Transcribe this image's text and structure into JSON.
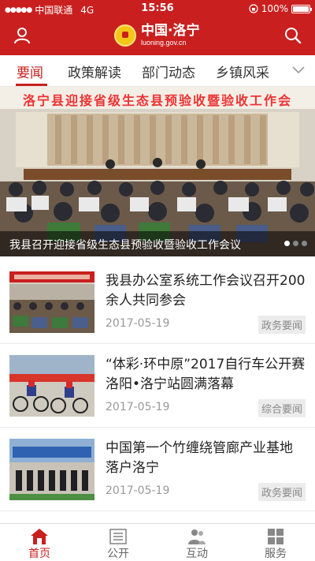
{
  "status_bar": {
    "carrier": "中国联通",
    "network": "4G",
    "time": "15:56",
    "battery": "100%"
  },
  "header": {
    "logo_title": "中国·洛宁",
    "logo_domain": "luoning.gov.cn",
    "user_icon": "user-icon",
    "search_icon": "search-icon"
  },
  "tabs": [
    {
      "label": "要闻",
      "active": true
    },
    {
      "label": "政策解读",
      "active": false
    },
    {
      "label": "部门动态",
      "active": false
    },
    {
      "label": "乡镇风采",
      "active": false
    }
  ],
  "banner": {
    "top_text": "洛宁县迎接省级生态县预验收暨验收工作会",
    "caption": "我县召开迎接省级生态县预验收暨验收工作会议",
    "pages": 3,
    "current_page": 1
  },
  "news": [
    {
      "title": "我县办公室系统工作会议召开200余人共同参会",
      "date": "2017-05-19",
      "tag": "政务要闻"
    },
    {
      "title": "“体彩·环中原”2017自行车公开赛洛阳•洛宁站圆满落幕",
      "date": "2017-05-19",
      "tag": "综合要闻"
    },
    {
      "title": "中国第一个竹缠绕管廊产业基地落户洛宁",
      "date": "2017-05-19",
      "tag": "政务要闻"
    }
  ],
  "bottom_nav": [
    {
      "label": "首页",
      "icon": "home-icon",
      "active": true
    },
    {
      "label": "公开",
      "icon": "document-list-icon",
      "active": false
    },
    {
      "label": "互动",
      "icon": "people-icon",
      "active": false
    },
    {
      "label": "服务",
      "icon": "grid-icon",
      "active": false
    }
  ],
  "colors": {
    "brand_red": "#c9201f",
    "tag_bg": "#ececec",
    "date_gray": "#999999"
  }
}
